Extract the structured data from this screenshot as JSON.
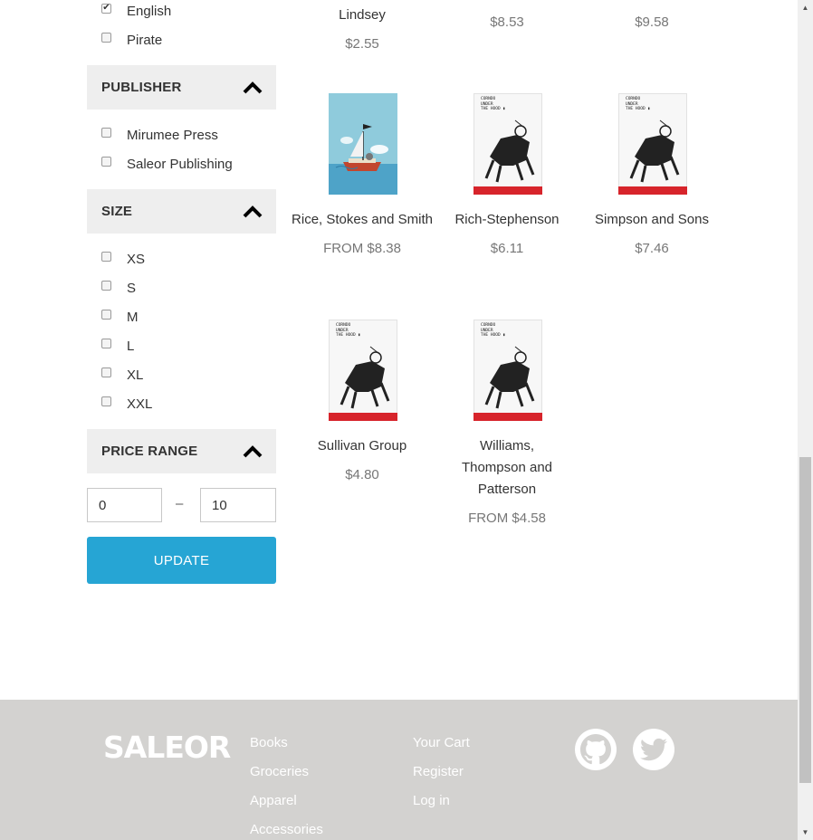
{
  "filters": {
    "language": {
      "options": [
        {
          "label": "English",
          "checked": true
        },
        {
          "label": "Pirate",
          "checked": false
        }
      ]
    },
    "publisher": {
      "title": "PUBLISHER",
      "options": [
        {
          "label": "Mirumee Press",
          "checked": false
        },
        {
          "label": "Saleor Publishing",
          "checked": false
        }
      ]
    },
    "size": {
      "title": "SIZE",
      "options": [
        {
          "label": "XS"
        },
        {
          "label": "S"
        },
        {
          "label": "M"
        },
        {
          "label": "L"
        },
        {
          "label": "XL"
        },
        {
          "label": "XXL"
        }
      ]
    },
    "price_range": {
      "title": "PRICE RANGE",
      "min": "0",
      "max": "10",
      "separator": "–",
      "update_label": "UPDATE"
    }
  },
  "products": {
    "top_row": [
      {
        "name": "Lindsey",
        "price": "$2.55"
      },
      {
        "price": "$8.53"
      },
      {
        "price": "$9.58"
      }
    ],
    "items": [
      {
        "name": "Rice, Stokes and Smith",
        "price": "FROM $8.38",
        "cover": "pirate-ship"
      },
      {
        "name": "Rich-Stephenson",
        "price": "$6.11",
        "cover": "robot"
      },
      {
        "name": "Simpson and Sons",
        "price": "$7.46",
        "cover": "robot"
      },
      {
        "name": "Sullivan Group",
        "price": "$4.80",
        "cover": "robot"
      },
      {
        "name": "Williams, Thompson and Patterson",
        "price": "FROM $4.58",
        "cover": "robot"
      }
    ]
  },
  "footer": {
    "logo": "SALEOR",
    "links_col1": [
      "Books",
      "Groceries",
      "Apparel",
      "Accessories"
    ],
    "links_col2": [
      "Your Cart",
      "Register",
      "Log in"
    ],
    "social": [
      "github-icon",
      "twitter-icon"
    ],
    "colors": {
      "background": "#d3d2d0",
      "accent": "#26a5d4"
    }
  }
}
